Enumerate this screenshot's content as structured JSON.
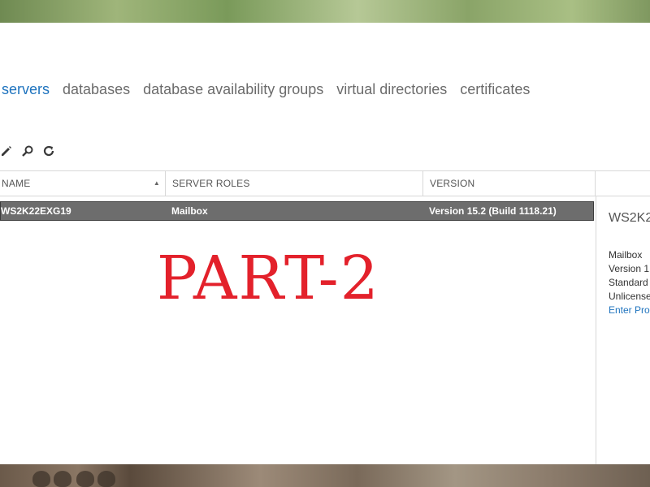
{
  "tabs": [
    {
      "label": "servers",
      "active": true
    },
    {
      "label": "databases",
      "active": false
    },
    {
      "label": "database availability groups",
      "active": false
    },
    {
      "label": "virtual directories",
      "active": false
    },
    {
      "label": "certificates",
      "active": false
    }
  ],
  "toolbar": {
    "icons": [
      "edit-icon",
      "search-icon",
      "refresh-icon"
    ]
  },
  "table": {
    "columns": [
      "NAME",
      "SERVER ROLES",
      "VERSION"
    ],
    "sort": "ascending",
    "rows": [
      {
        "name": "WS2K22EXG19",
        "roles": "Mailbox",
        "version": "Version 15.2 (Build 1118.21)"
      }
    ]
  },
  "details": {
    "title": "WS2K2",
    "lines": [
      "Mailbox",
      "Version 1",
      "Standard",
      "Unlicense"
    ],
    "link": "Enter Prod"
  },
  "overlay": {
    "text": "PART-2",
    "color": "#e3212b"
  },
  "colors": {
    "accent": "#1e73be",
    "selected_row": "#6d6d6d"
  }
}
